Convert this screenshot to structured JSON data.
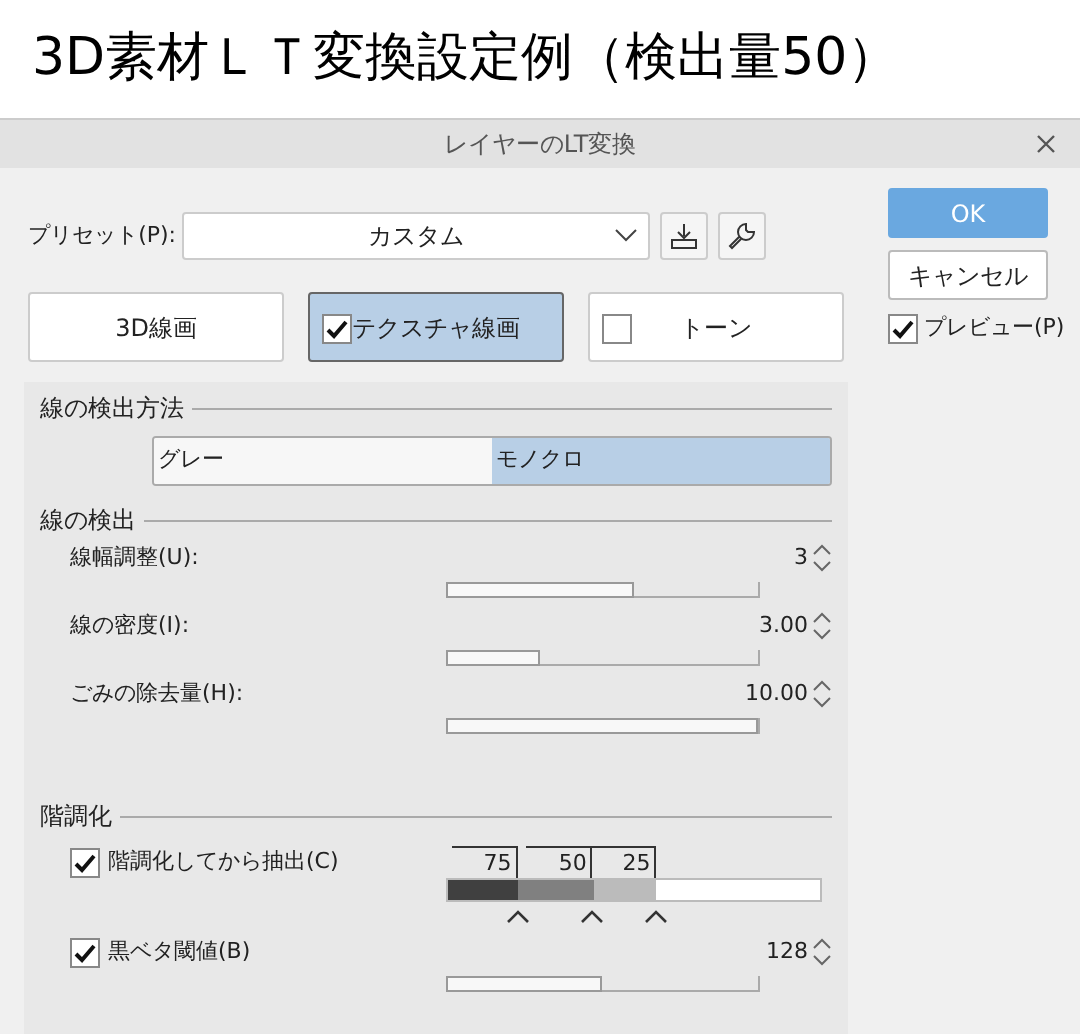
{
  "heading": "3D素材ＬＴ変換設定例（検出量50）",
  "window": {
    "title": "レイヤーのLT変換"
  },
  "preset": {
    "label": "プリセット(P):",
    "value": "カスタム"
  },
  "buttons": [
    {
      "label": "OK",
      "kind": "primary"
    },
    {
      "label": "キャンセル",
      "kind": "normal"
    }
  ],
  "preview": {
    "label": "プレビュー(P)",
    "checked": true
  },
  "modes": [
    {
      "label": "3D線画",
      "kind": "button",
      "selected": false
    },
    {
      "label": "テクスチャ線画",
      "kind": "checkbox",
      "checked": true,
      "selected": true
    },
    {
      "label": "トーン",
      "kind": "checkbox",
      "checked": false,
      "selected": false
    }
  ],
  "detection_method": {
    "title": "線の検出方法",
    "options": [
      {
        "label": "グレー",
        "selected": false
      },
      {
        "label": "モノクロ",
        "selected": true
      }
    ]
  },
  "detection": {
    "title": "線の検出",
    "sliders": [
      {
        "label": "線幅調整(U):",
        "reading": "3",
        "level": 0.6
      },
      {
        "label": "線の密度(I):",
        "reading": "3.00",
        "level": 0.3
      },
      {
        "label": "ごみの除去量(H):",
        "reading": "10.00",
        "level": 1.0
      }
    ]
  },
  "gradation": {
    "title": "階調化",
    "posterize": {
      "label": "階調化してから抽出(C)",
      "checked": true,
      "thresholds": [
        {
          "value": "75",
          "level": 0.19
        },
        {
          "value": "50",
          "level": 0.39
        },
        {
          "value": "25",
          "level": 0.56
        }
      ]
    },
    "black_fill": {
      "label": "黒ベタ閾値(B)",
      "checked": true,
      "reading": "128",
      "level": 0.5
    }
  }
}
